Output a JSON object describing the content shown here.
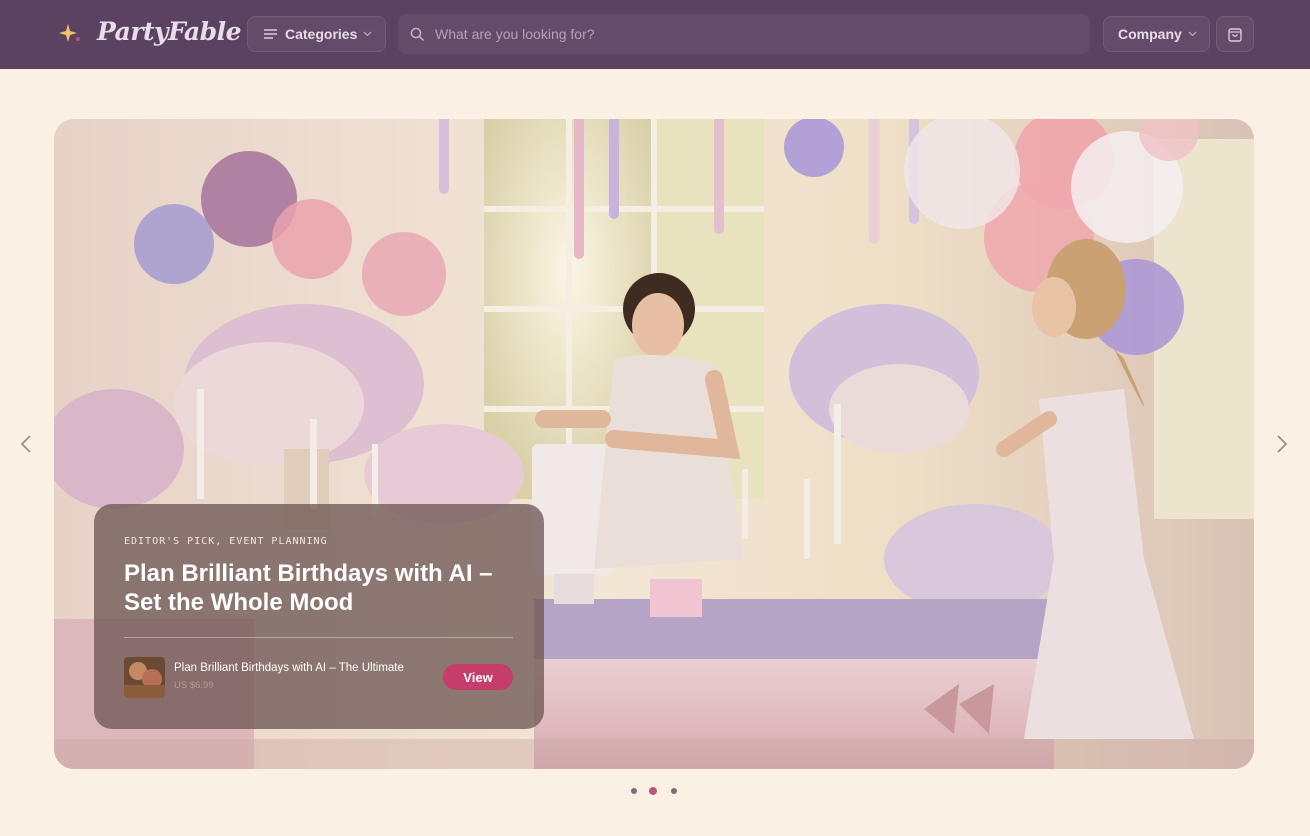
{
  "header": {
    "logo_text": "PartyFable",
    "categories_label": "Categories",
    "search_placeholder": "What are you looking for?",
    "company_label": "Company"
  },
  "hero": {
    "kicker": "EDITOR'S PICK, EVENT PLANNING",
    "headline": "Plan Brilliant Birthdays with AI – Set the Whole Mood",
    "product_name": "Plan Brilliant Birthdays with AI – The Ultimate",
    "product_price": "US $6.99",
    "view_label": "View"
  },
  "carousel": {
    "slide_count": 3,
    "active_slide": 2
  },
  "colors": {
    "header_bg": "#5a4260",
    "page_bg": "#fbf0e4",
    "accent": "#c63d6c"
  },
  "icons": [
    "sparkle-icon",
    "menu-icon",
    "chevron-down-icon",
    "search-icon",
    "shopping-bag-icon",
    "chevron-left-icon",
    "chevron-right-icon"
  ]
}
